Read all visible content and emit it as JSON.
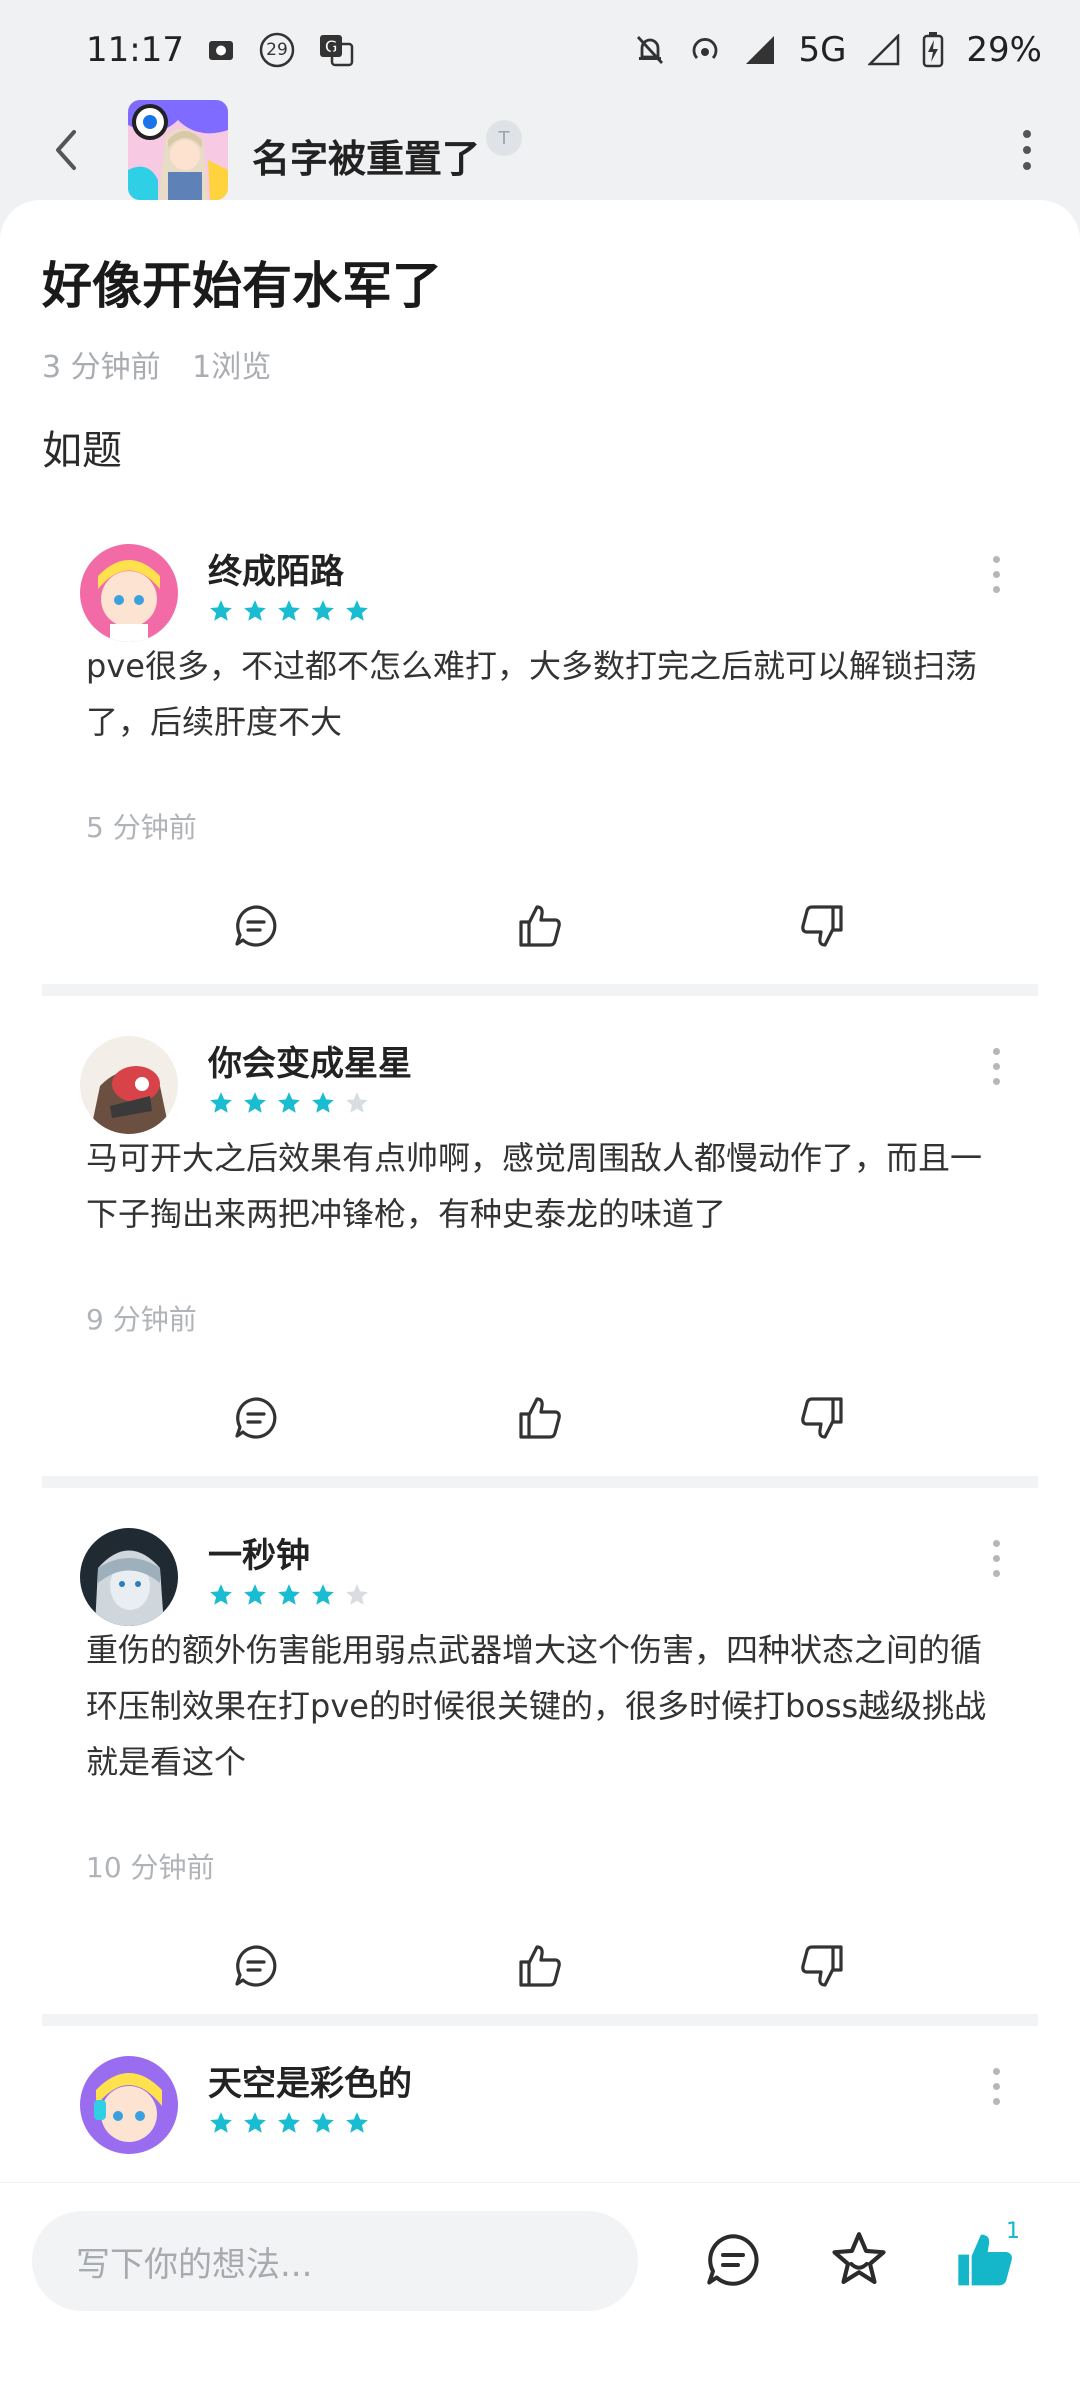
{
  "status_bar": {
    "time": "11:17",
    "notification_count": "29",
    "network": "5G",
    "battery": "29%"
  },
  "header": {
    "author_name": "名字被重置了",
    "badge_text": "T"
  },
  "post": {
    "title": "好像开始有水军了",
    "time": "3 分钟前",
    "views": "1浏览",
    "body": "如题"
  },
  "comments": [
    {
      "name": "终成陌路",
      "stars": 5,
      "text": "pve很多，不过都不怎么难打，大多数打完之后就可以解锁扫荡了，后续肝度不大",
      "time": "5 分钟前"
    },
    {
      "name": "你会变成星星",
      "stars": 4,
      "text": "马可开大之后效果有点帅啊，感觉周围敌人都慢动作了，而且一下子掏出来两把冲锋枪，有种史泰龙的味道了",
      "time": "9 分钟前"
    },
    {
      "name": "一秒钟",
      "stars": 4,
      "text": "重伤的额外伤害能用弱点武器增大这个伤害，四种状态之间的循环压制效果在打pve的时候很关键的，很多时候打boss越级挑战就是看这个",
      "time": "10 分钟前"
    },
    {
      "name": "天空是彩色的",
      "stars": 5,
      "text": "",
      "time": ""
    }
  ],
  "bottom_bar": {
    "input_placeholder": "写下你的想法...",
    "like_count": "1"
  },
  "colors": {
    "accent": "#14b7c9",
    "star_filled": "#19bcd0",
    "star_empty": "#d9dce0"
  }
}
